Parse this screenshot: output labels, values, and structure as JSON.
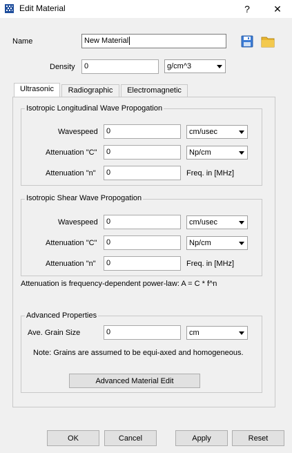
{
  "window": {
    "title": "Edit Material",
    "help_glyph": "?",
    "close_glyph": "✕"
  },
  "name": {
    "label": "Name",
    "value": "New Material"
  },
  "density": {
    "label": "Density",
    "value": "0",
    "unit": "g/cm^3"
  },
  "tabs": [
    "Ultrasonic",
    "Radiographic",
    "Electromagnetic"
  ],
  "longitudinal": {
    "title": "Isotropic Longitudinal Wave Propogation",
    "wavespeed": {
      "label": "Wavespeed",
      "value": "0",
      "unit": "cm/usec"
    },
    "atten_c": {
      "label": "Attenuation \"C\"",
      "value": "0",
      "unit": "Np/cm"
    },
    "atten_n": {
      "label": "Attenuation \"n\"",
      "value": "0",
      "note": "Freq. in [MHz]"
    }
  },
  "shear": {
    "title": "Isotropic Shear Wave Propogation",
    "wavespeed": {
      "label": "Wavespeed",
      "value": "0",
      "unit": "cm/usec"
    },
    "atten_c": {
      "label": "Attenuation \"C\"",
      "value": "0",
      "unit": "Np/cm"
    },
    "atten_n": {
      "label": "Attenuation \"n\"",
      "value": "0",
      "note": "Freq. in [MHz]"
    }
  },
  "formula_note": "Attenuation is frequency-dependent power-law: A = C * f^n",
  "advanced": {
    "title": "Advanced Properties",
    "grain": {
      "label": "Ave. Grain Size",
      "value": "0",
      "unit": "cm"
    },
    "note": "Note: Grains are assumed to be equi-axed and homogeneous.",
    "edit_button": "Advanced Material Edit"
  },
  "buttons": {
    "ok": "OK",
    "cancel": "Cancel",
    "apply": "Apply",
    "reset": "Reset"
  },
  "colors": {
    "save_icon": "#3a7bd5",
    "folder_icon": "#e8b530"
  }
}
